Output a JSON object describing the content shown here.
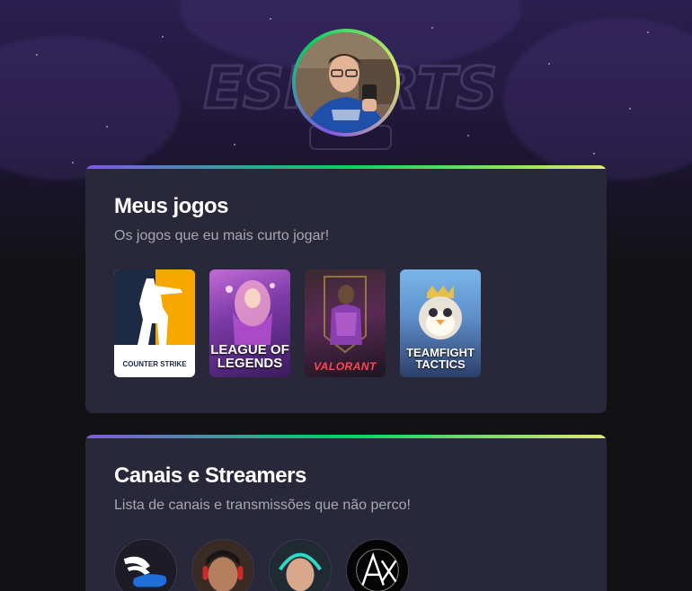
{
  "profile": {
    "avatar": "profile-photo"
  },
  "background": {
    "watermark_text": "ESPORTS"
  },
  "games_section": {
    "title": "Meus jogos",
    "subtitle": "Os jogos que eu mais curto jogar!",
    "games": [
      {
        "name": "COUNTER STRIKE",
        "color": "#f6a800"
      },
      {
        "name": "LEAGUE OF LEGENDS",
        "color": "#7c3aa8"
      },
      {
        "name": "VALORANT",
        "color": "#ff4655"
      },
      {
        "name": "TEAMFIGHT TACTICS",
        "color": "#5d8ec9"
      }
    ]
  },
  "streams_section": {
    "title": "Canais e Streamers",
    "subtitle": "Lista de canais e transmissões que não perco!",
    "channels": [
      {
        "icon": "winged-shoe-icon"
      },
      {
        "icon": "streamer-avatar"
      },
      {
        "icon": "streamer-avatar"
      },
      {
        "icon": "ax-logo-icon"
      }
    ]
  },
  "colors": {
    "accent_purple": "#8257e5",
    "accent_green": "#04d361",
    "accent_yellow": "#e1e86a",
    "card_bg": "#29273a",
    "page_bg": "#121214"
  }
}
